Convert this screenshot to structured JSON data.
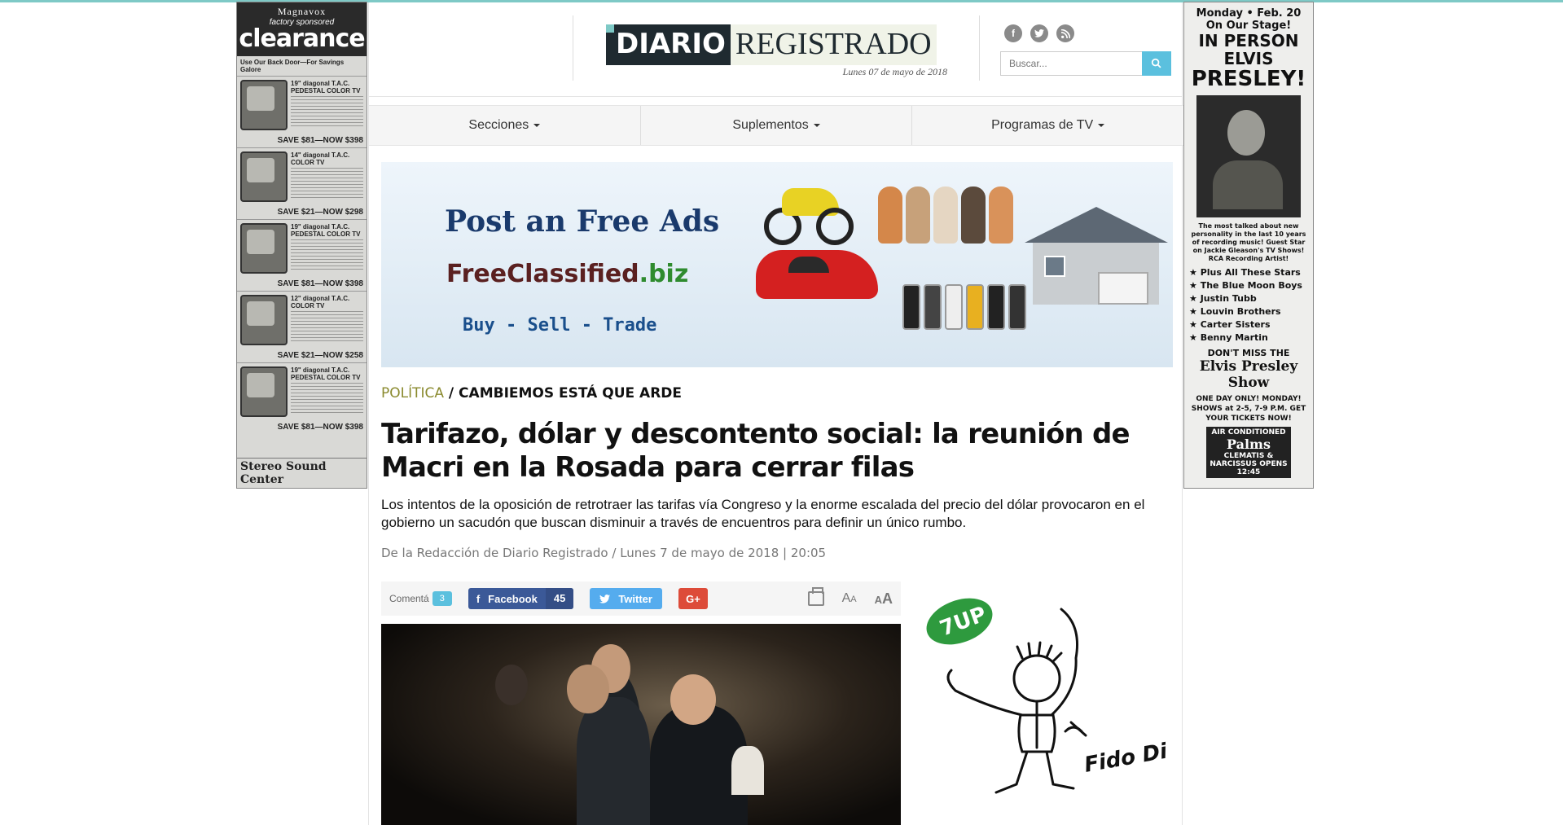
{
  "left_ad": {
    "brand": "Magnavox",
    "sub": "factory sponsored",
    "headline": "clearance",
    "tagline": "Use Our Back Door—For Savings Galore",
    "items": [
      {
        "name": "19\" diagonal T.A.C. PEDESTAL COLOR TV",
        "price": "SAVE $81—NOW $398"
      },
      {
        "name": "14\" diagonal T.A.C. COLOR TV",
        "price": "SAVE $21—NOW $298"
      },
      {
        "name": "19\" diagonal T.A.C. PEDESTAL COLOR TV",
        "price": "SAVE $81—NOW $398"
      },
      {
        "name": "12\" diagonal T.A.C. COLOR TV",
        "price": "SAVE $21—NOW $258"
      },
      {
        "name": "19\" diagonal T.A.C. PEDESTAL COLOR TV",
        "price": "SAVE $81—NOW $398"
      }
    ],
    "footer": "Stereo Sound Center"
  },
  "right_ad": {
    "date": "Monday • Feb. 20",
    "stage": "On Our Stage!",
    "in_person": "IN PERSON",
    "elvis": "ELVIS",
    "presley": "PRESLEY!",
    "blurb": "The most talked about new personality in the last 10 years of recording music! Guest Star on Jackie Gleason's TV Shows! RCA Recording Artist!",
    "stars": [
      "Plus All These Stars",
      "The Blue Moon Boys",
      "Justin Tubb",
      "Louvin Brothers",
      "Carter Sisters",
      "Benny Martin"
    ],
    "dont_miss": "DON'T MISS THE",
    "show": "Elvis Presley Show",
    "schedule": "ONE DAY ONLY! MONDAY! SHOWS at 2-5, 7-9 P.M. GET YOUR TICKETS NOW!",
    "venue_top": "AIR CONDITIONED",
    "venue": "Palms",
    "venue_bottom": "CLEMATIS & NARCISSUS OPENS 12:45"
  },
  "header": {
    "logo_part1": "DIARIO",
    "logo_part2": "REGISTRADO",
    "date": "Lunes 07 de mayo de 2018",
    "social_icons": [
      "facebook-icon",
      "twitter-icon",
      "rss-icon"
    ],
    "search_placeholder": "Buscar..."
  },
  "nav": {
    "items": [
      "Secciones",
      "Suplementos",
      "Programas de TV"
    ]
  },
  "banner": {
    "line1": "Post an Free Ads",
    "line2_a": "FreeClassified",
    "line2_b": ".biz",
    "line3": "Buy - Sell - Trade"
  },
  "article": {
    "section": "POLÍTICA",
    "tag": " / CAMBIEMOS ESTÁ QUE ARDE",
    "title": "Tarifazo, dólar y descontento social: la reunión de Macri en la Rosada para cerrar filas",
    "lead": "Los intentos de la oposición de retrotraer las tarifas vía Congreso y la enorme escalada del precio del dólar provocaron en el gobierno un sacudón que buscan disminuir a través de encuentros para definir un único rumbo.",
    "byline": "De la Redacción de Diario Registrado / Lunes 7 de mayo de 2018 | 20:05"
  },
  "share": {
    "comenta_label": "Comentá",
    "comment_count": "3",
    "facebook_label": "Facebook",
    "facebook_count": "45",
    "twitter_label": "Twitter",
    "gplus_label": "G+",
    "font_small": "A",
    "font_small_sub": "A",
    "font_big": "A",
    "font_big_sub": "A"
  },
  "side_ad_7up": {
    "brand": "7UP",
    "character": "Fido Dido"
  },
  "colors": {
    "accent": "#7ec9c6",
    "search_button": "#5bc0de",
    "facebook": "#3b5998",
    "twitter": "#55acee",
    "gplus": "#dd4b39",
    "section": "#8a8a2e"
  }
}
